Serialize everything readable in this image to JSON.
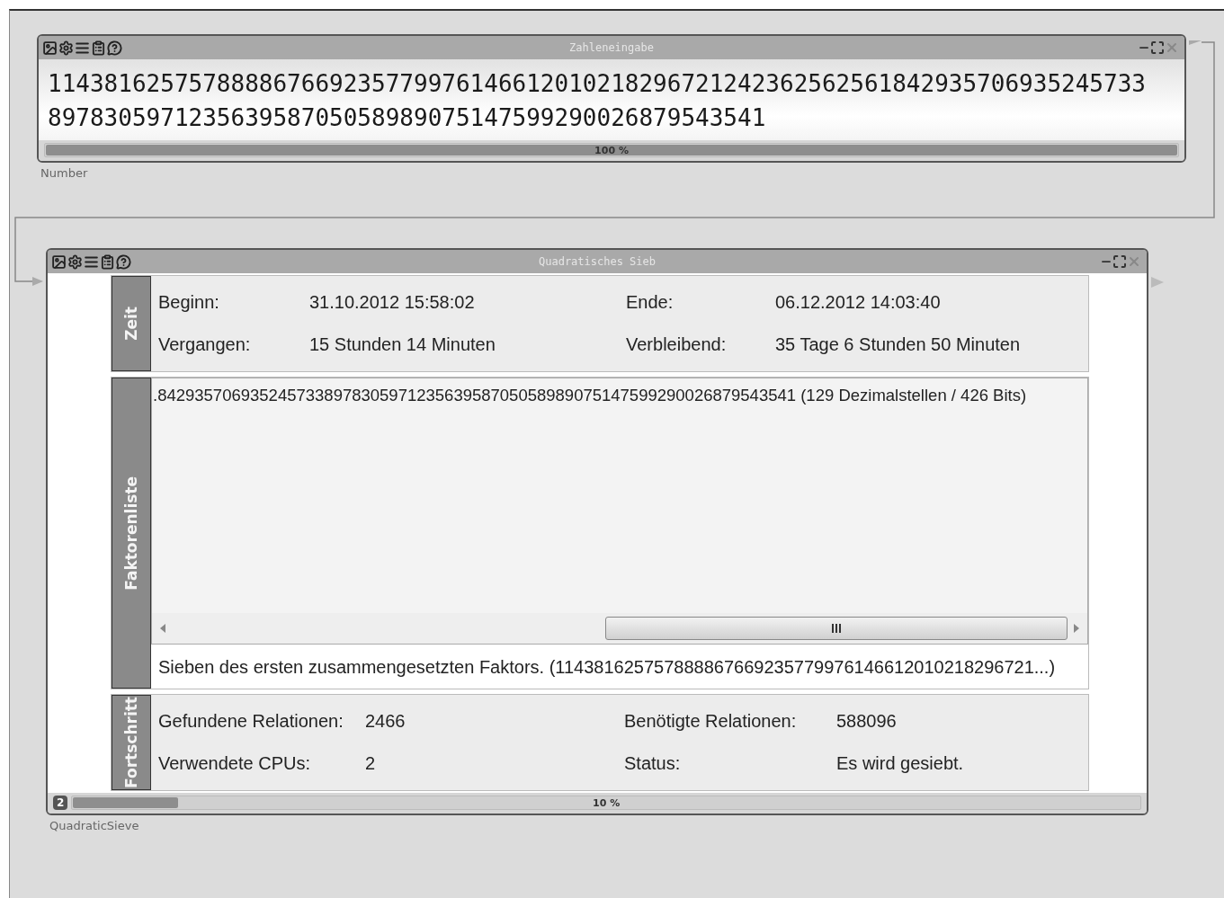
{
  "modules": [
    {
      "kind": "input",
      "title": "Zahleneingabe",
      "caption": "Number",
      "number_lines": [
        "114381625757888867669235779976146612010218296721242362562561842935706935245733",
        "897830597123563958705058989075147599290026879543541"
      ],
      "progress": {
        "level": 1,
        "label": "100 %"
      }
    },
    {
      "kind": "sieve",
      "title": "Quadratisches Sieb",
      "caption": "QuadraticSieve",
      "badge": "2",
      "progress": {
        "level": 0.1,
        "label": "10 %"
      },
      "sections": [
        {
          "kind": "fields",
          "tab": "Zeit",
          "fields": [
            {
              "label": "Beginn:",
              "value": "31.10.2012 15:58:02"
            },
            {
              "label": "Ende:",
              "value": "06.12.2012 14:03:40"
            },
            {
              "label": "Vergangen:",
              "value": "15 Stunden 14 Minuten"
            },
            {
              "label": "Verbleibend:",
              "value": "35 Tage 6 Stunden 50 Minuten"
            }
          ]
        },
        {
          "kind": "list",
          "tab": "Faktorenliste",
          "items": [
            ".842935706935245733897830597123563958705058989075147599290026879543541 (129 Dezimalstellen / 426 Bits)"
          ],
          "footer": "Sieben des ersten zusammengesetzten Faktors. (114381625757888867669235779976146612010218296721...)"
        },
        {
          "kind": "fields",
          "tab": "Fortschritt",
          "fields": [
            {
              "label": "Gefundene Relationen:",
              "value": "2466"
            },
            {
              "label": "Benötigte Relationen:",
              "value": "588096"
            },
            {
              "label": "Verwendete CPUs:",
              "value": "2"
            },
            {
              "label": "Status:",
              "value": "Es wird gesiebt."
            }
          ]
        }
      ]
    }
  ]
}
